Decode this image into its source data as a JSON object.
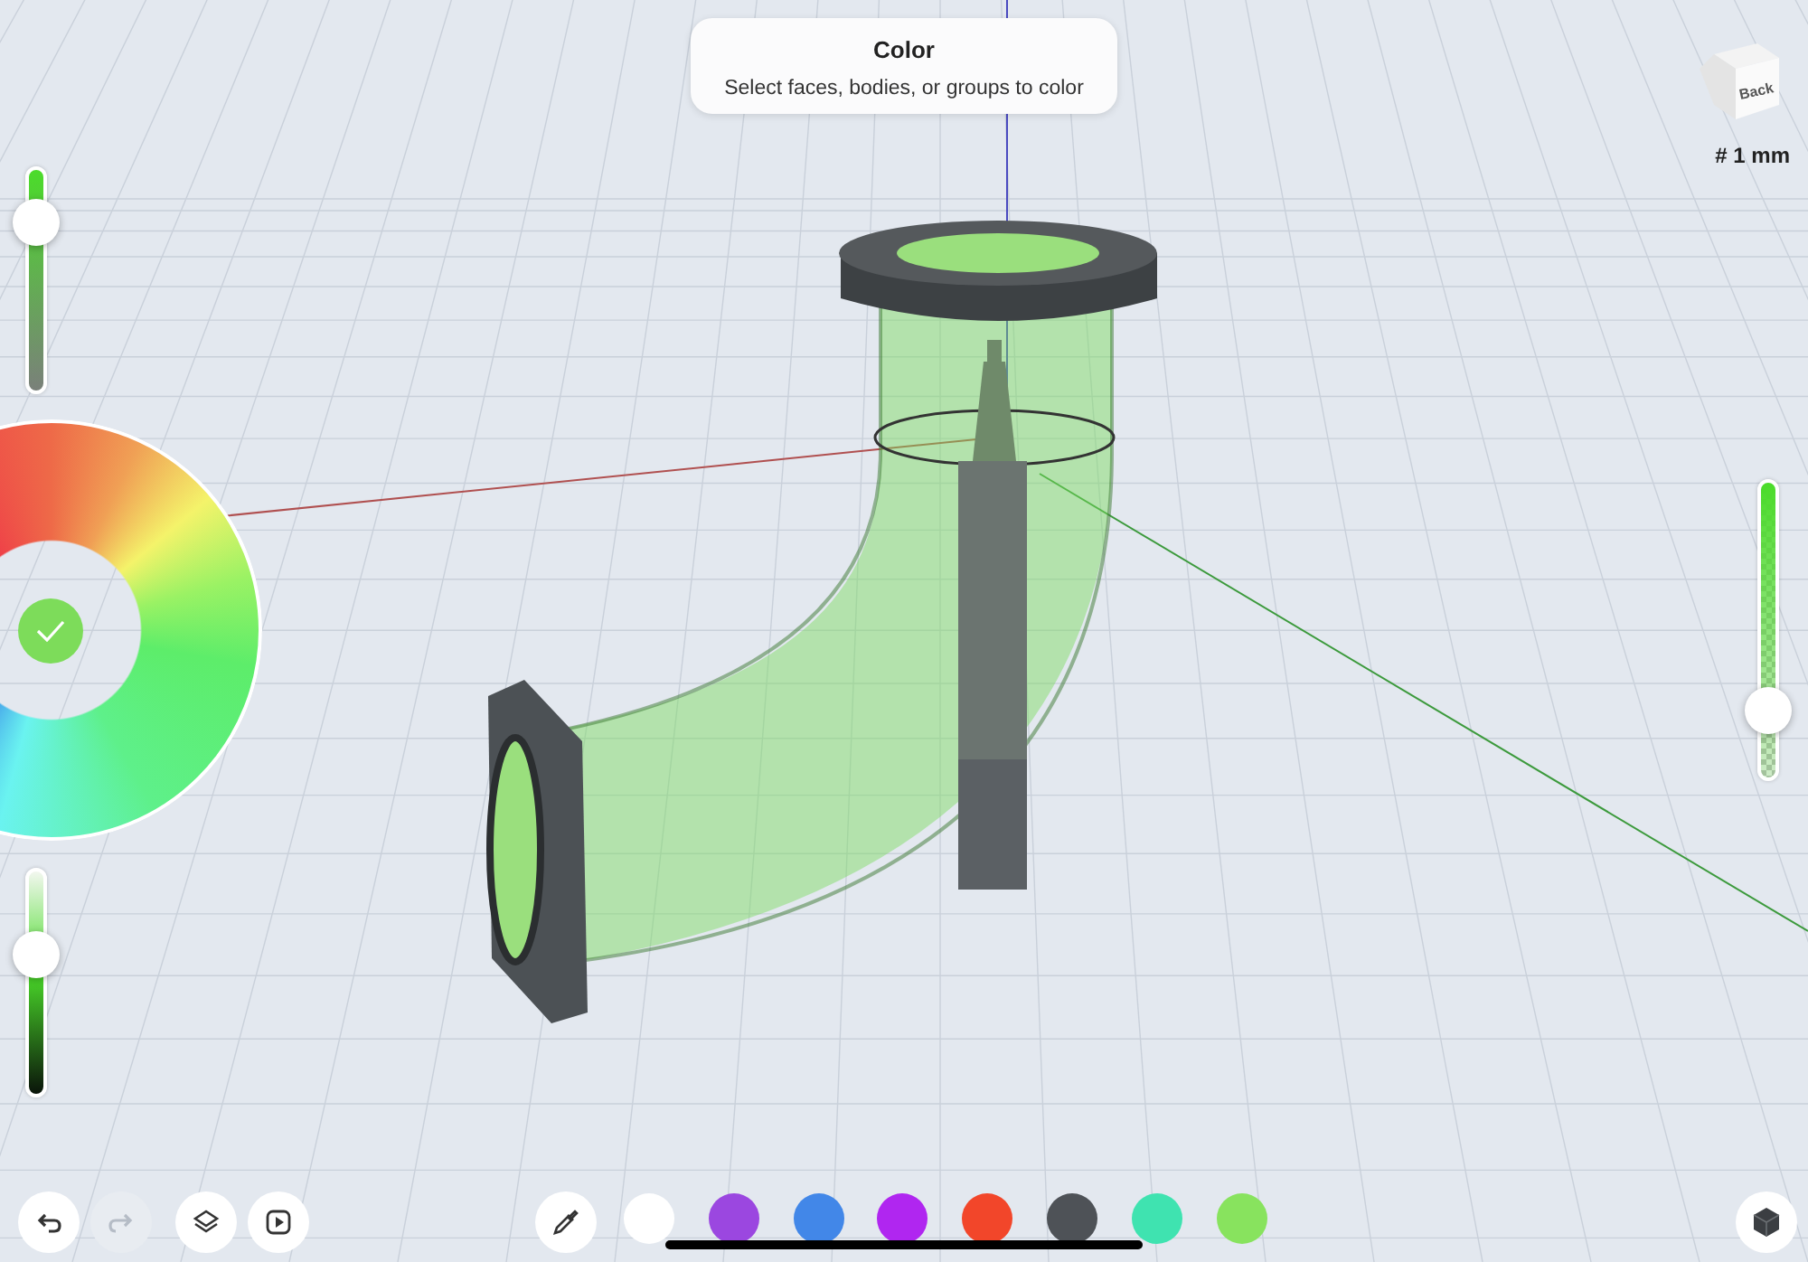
{
  "hint": {
    "title": "Color",
    "text": "Select faces, bodies, or groups to color"
  },
  "view_cube": {
    "face": "Back"
  },
  "grid_size": "# 1 mm",
  "sliders": [
    {
      "kind": "saturation",
      "level": 0.76
    },
    {
      "kind": "brightness",
      "level": 0.63
    },
    {
      "kind": "opacity",
      "level": 0.23
    }
  ],
  "color_wheel": {
    "color": "#7ddc5a"
  },
  "toolbar": [
    {
      "kind": "undo",
      "disabled": false
    },
    {
      "kind": "redo",
      "disabled": true
    },
    {
      "kind": "layers",
      "disabled": false
    },
    {
      "kind": "play",
      "disabled": false
    }
  ],
  "swatches": [
    {
      "color": "#ffffff"
    },
    {
      "color": "#9b47e0"
    },
    {
      "color": "#4287e8"
    },
    {
      "color": "#b026f0"
    },
    {
      "color": "#f2462a"
    },
    {
      "color": "#4e5257"
    },
    {
      "color": "#3fe3b0"
    },
    {
      "color": "#88e35e"
    }
  ]
}
